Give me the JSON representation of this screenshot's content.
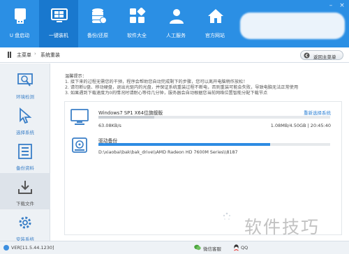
{
  "window_controls": [
    "–",
    "×"
  ],
  "nav": {
    "items": [
      {
        "label": "U 盘启动",
        "icon": "usb-drive-icon"
      },
      {
        "label": "一键装机",
        "icon": "monitor-install-icon",
        "active": true
      },
      {
        "label": "备份/还原",
        "icon": "database-backup-icon"
      },
      {
        "label": "软件大全",
        "icon": "apps-grid-icon"
      },
      {
        "label": "人工服务",
        "icon": "support-person-icon"
      },
      {
        "label": "官方网站",
        "icon": "house-icon"
      }
    ]
  },
  "breadcrumb": {
    "home": "主菜单",
    "separator": "›",
    "current": "系统重装"
  },
  "back_button": "返回主菜单",
  "sidebar": {
    "items": [
      {
        "label": "环境检测",
        "icon": "search-detect-icon"
      },
      {
        "label": "选择系统",
        "icon": "cursor-select-icon"
      },
      {
        "label": "备份资料",
        "icon": "files-backup-icon"
      },
      {
        "label": "下载文件",
        "icon": "download-icon",
        "active": true
      },
      {
        "label": "安装系统",
        "icon": "gear-install-icon"
      }
    ]
  },
  "tips": {
    "title": "温馨提示：",
    "lines": [
      "1. 接下来的过程无需您的干预，程序会帮助您自动完成剩下的步骤，您可以离开电脑稍作放松！",
      "2. 请勿断U盘、移动硬盘，退出光驱内的光盘，并保证系统重装过程不断电，否则重装可能会失败，导致电脑无法正常使用",
      "3. 如果遇到下载速度为0的情况时请耐心等待几分钟，服务器会自动根据您当前网络位置智能分配下载节点"
    ]
  },
  "download": {
    "title": "Windows7 SP1 X64位旗舰版",
    "reselect": "重新选择系统",
    "progress": 0.24,
    "speed": "63.08KB/s",
    "size_time": "1.08MB/4.50GB | 20:45:40"
  },
  "backup": {
    "title": "驱动备份",
    "progress": 0.74,
    "path": "D:\\xiaobai\\bak\\bak_drive\\\\AMD Radeon HD 7600M Series\\\\8187"
  },
  "status": {
    "version": "VER[11.5.44.1230]",
    "wechat": "微信客服",
    "qq": "QQ"
  },
  "watermark": "软件技巧",
  "colors": {
    "header_blue": "#2b8fe4",
    "active_blue": "#1978ce",
    "progress_blue": "#2d8be3",
    "link_blue": "#2a7fd4"
  }
}
